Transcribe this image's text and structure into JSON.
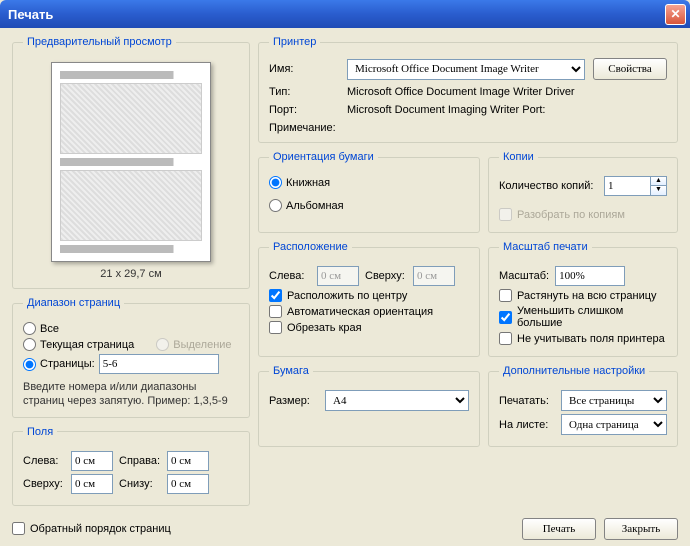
{
  "title": "Печать",
  "preview": {
    "legend": "Предварительный просмотр",
    "caption": "21 x 29,7 см"
  },
  "range": {
    "legend": "Диапазон страниц",
    "all": "Все",
    "current": "Текущая страница",
    "selection": "Выделение",
    "pages": "Страницы:",
    "pages_value": "5-6",
    "hint": "Введите номера и/или диапазоны страниц через запятую. Пример: 1,3,5-9"
  },
  "margins": {
    "legend": "Поля",
    "left": "Слева:",
    "left_v": "0 см",
    "right": "Справа:",
    "right_v": "0 см",
    "top": "Сверху:",
    "top_v": "0 см",
    "bottom": "Снизу:",
    "bottom_v": "0 см"
  },
  "printer": {
    "legend": "Принтер",
    "name_label": "Имя:",
    "name_value": "Microsoft Office Document Image Writer",
    "props_btn": "Свойства",
    "type_label": "Тип:",
    "type_value": "Microsoft Office Document Image Writer Driver",
    "port_label": "Порт:",
    "port_value": "Microsoft Document Imaging Writer Port:",
    "note_label": "Примечание:",
    "note_value": ""
  },
  "orient": {
    "legend": "Ориентация бумаги",
    "portrait": "Книжная",
    "landscape": "Альбомная"
  },
  "copies": {
    "legend": "Копии",
    "count_label": "Количество копий:",
    "count_value": "1",
    "collate": "Разобрать по копиям"
  },
  "layout": {
    "legend": "Расположение",
    "left": "Слева:",
    "left_v": "0 см",
    "top": "Сверху:",
    "top_v": "0 см",
    "center": "Расположить по центру",
    "auto": "Автоматическая ориентация",
    "crop": "Обрезать края"
  },
  "scale": {
    "legend": "Масштаб печати",
    "label": "Масштаб:",
    "value": "100%",
    "fit": "Растянуть на всю страницу",
    "shrink": "Уменьшить слишком большие",
    "ignore_margins": "Не учитывать поля принтера"
  },
  "paper": {
    "legend": "Бумага",
    "size_label": "Размер:",
    "size_value": "A4"
  },
  "extra": {
    "legend": "Дополнительные настройки",
    "print_label": "Печатать:",
    "print_value": "Все страницы",
    "sheet_label": "На листе:",
    "sheet_value": "Одна страница"
  },
  "reverse": "Обратный порядок страниц",
  "print_btn": "Печать",
  "close_btn": "Закрыть"
}
